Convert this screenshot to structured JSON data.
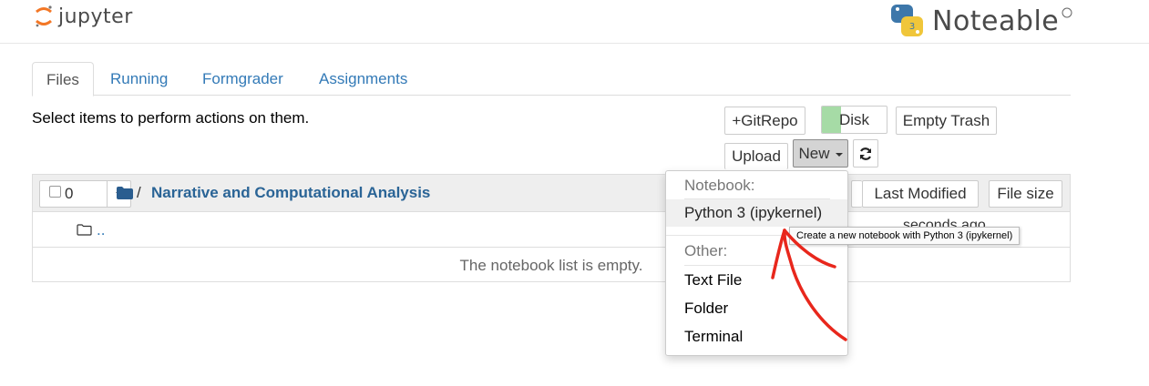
{
  "header": {
    "jupyter_label": "jupyter",
    "noteable_label": "Noteable",
    "python_badge": "3"
  },
  "tabs": [
    {
      "label": "Files",
      "active": true
    },
    {
      "label": "Running",
      "active": false
    },
    {
      "label": "Formgrader",
      "active": false
    },
    {
      "label": "Assignments",
      "active": false
    }
  ],
  "toolbar": {
    "hint": "Select items to perform actions on them.",
    "gitrepo_label": "+GitRepo",
    "disk_label": "Disk",
    "empty_trash_label": "Empty Trash",
    "upload_label": "Upload",
    "new_label": "New",
    "disk_usage_fraction": 0.3
  },
  "list": {
    "selected_count": "0",
    "breadcrumb_sep": "/",
    "folder_name": "Narrative and Computational Analysis",
    "parent_label": "..",
    "parent_modified": "seconds ago",
    "empty_message": "The notebook list is empty.",
    "sort_last_modified": "Last Modified",
    "sort_file_size": "File size"
  },
  "menu": {
    "notebook_header": "Notebook:",
    "python_item": "Python 3 (ipykernel)",
    "other_header": "Other:",
    "text_file_item": "Text File",
    "folder_item": "Folder",
    "terminal_item": "Terminal"
  },
  "tooltip": "Create a new notebook with Python 3 (ipykernel)",
  "colors": {
    "link": "#337ab7",
    "accent_annotation": "#e8271c",
    "disk_fill": "#a6dba6"
  }
}
